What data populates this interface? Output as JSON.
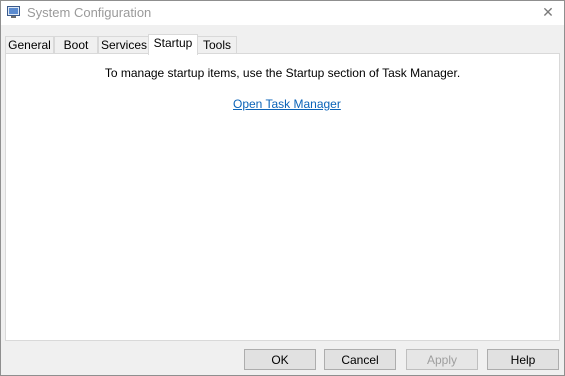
{
  "window": {
    "title": "System Configuration",
    "app_icon": "msconfig-icon",
    "close_glyph": "✕"
  },
  "tabs": [
    {
      "label": "General"
    },
    {
      "label": "Boot"
    },
    {
      "label": "Services"
    },
    {
      "label": "Startup",
      "active": true
    },
    {
      "label": "Tools"
    }
  ],
  "startup": {
    "message": "To manage startup items, use the Startup section of Task Manager.",
    "link_label": "Open Task Manager"
  },
  "buttons": {
    "ok": "OK",
    "cancel": "Cancel",
    "apply": "Apply",
    "help": "Help"
  },
  "colors": {
    "link": "#0b63b8",
    "disabled_text": "#9e9e9e"
  }
}
